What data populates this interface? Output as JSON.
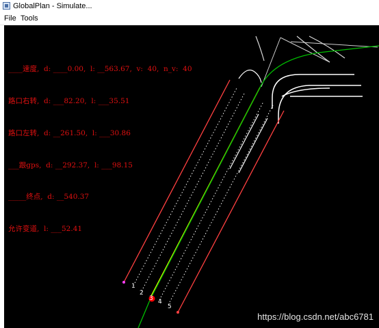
{
  "window": {
    "title": "GlobalPlan - Simulate..."
  },
  "menu": {
    "file": "File",
    "tools": "Tools"
  },
  "hud": {
    "lines": [
      "____速度,  d: ____0.00,  l: __563.67,  v:  40,  n_v:  40",
      "路口右转,  d: ___82.20,  l: ___35.51",
      "路口左转,  d: __261.50,  l: ___30.86",
      "___跟gps,  d: __292.37,  l: ___98.15",
      "_____终点,  d: __540.37",
      "允许变道,  l: ___52.41"
    ]
  },
  "lanes": {
    "labels": [
      "1",
      "2",
      "3",
      "4",
      "5"
    ]
  },
  "watermark": "https://blog.csdn.net/abc6781",
  "colors": {
    "background": "#000000",
    "boundary": "#ff4040",
    "route": "#00c000",
    "lane_marking": "#ffffff",
    "highlight_lane": "#ffff00",
    "vehicle": "#ff0000",
    "hud_text": "#e01010"
  }
}
